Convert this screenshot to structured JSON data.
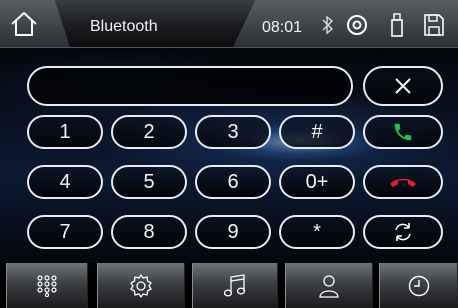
{
  "header": {
    "title": "Bluetooth",
    "clock": "08:01",
    "icons": [
      "home-icon",
      "bluetooth-icon",
      "disc-icon",
      "usb-icon",
      "sd-card-icon"
    ]
  },
  "keypad": {
    "keys": [
      "1",
      "2",
      "3",
      "#",
      "4",
      "5",
      "6",
      "0+",
      "7",
      "8",
      "9",
      "*"
    ],
    "actions": [
      "clear-icon",
      "call-answer-icon",
      "call-end-icon",
      "transfer-icon"
    ]
  },
  "bottom_nav": {
    "items": [
      "dialpad-icon",
      "settings-icon",
      "music-icon",
      "contacts-icon",
      "history-icon"
    ]
  },
  "colors": {
    "answer": "#19c44a",
    "hangup": "#e0202a",
    "outline": "#e8ecf2"
  }
}
